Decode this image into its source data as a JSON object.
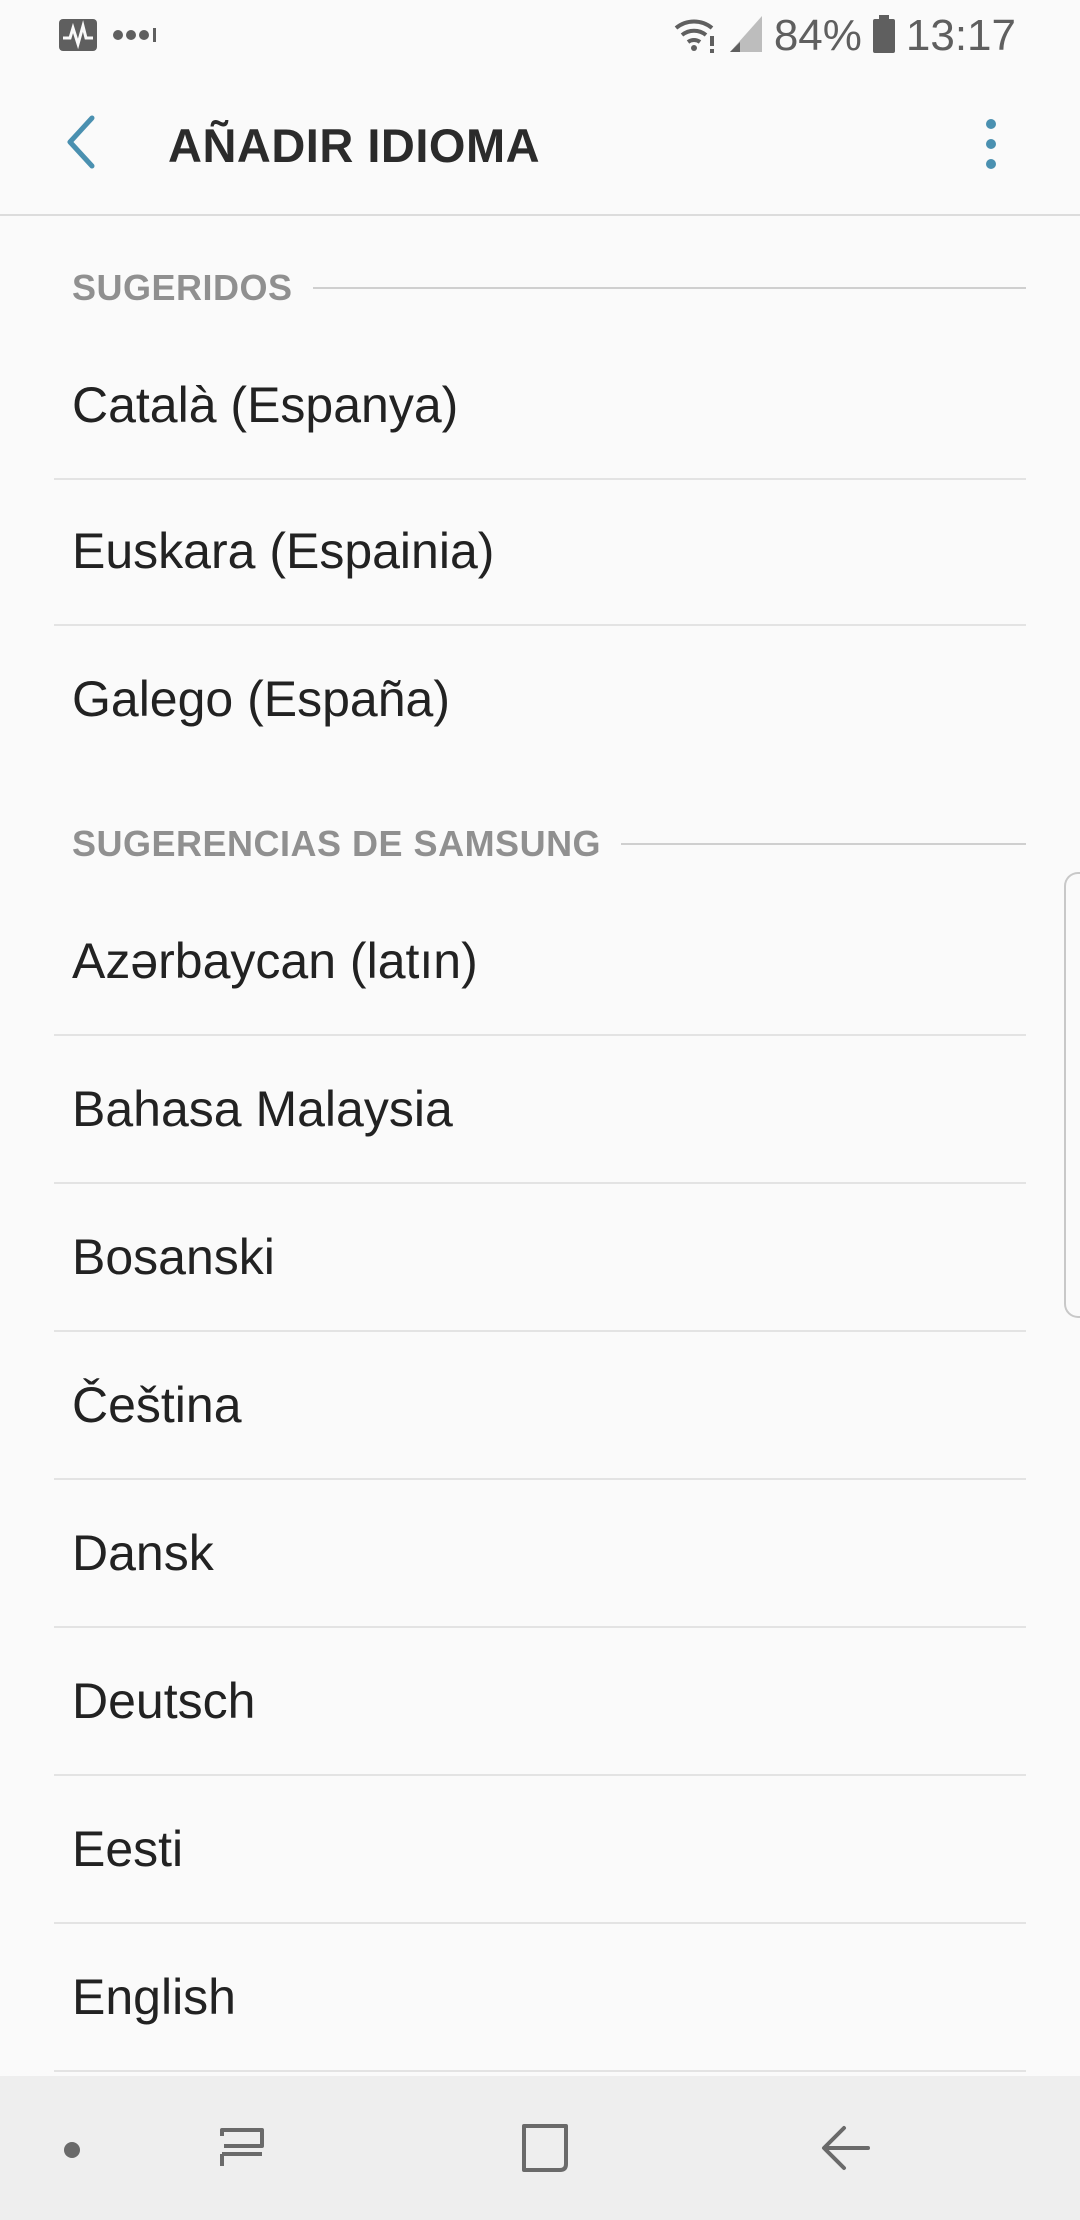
{
  "status_bar": {
    "battery_percent": "84%",
    "time": "13:17",
    "icons": [
      "activity-icon",
      "more-dots-icon",
      "wifi-icon",
      "signal-icon",
      "battery-icon"
    ]
  },
  "app_bar": {
    "title": "AÑADIR IDIOMA",
    "back_icon": "back-arrow-icon",
    "more_icon": "more-vert-icon"
  },
  "sections": [
    {
      "title": "SUGERIDOS",
      "items": [
        "Català (Espanya)",
        "Euskara (Espainia)",
        "Galego (España)"
      ]
    },
    {
      "title": "SUGERENCIAS DE SAMSUNG",
      "items": [
        "Azərbaycan (latın)",
        "Bahasa Malaysia",
        "Bosanski",
        "Čeština",
        "Dansk",
        "Deutsch",
        "Eesti",
        "English"
      ]
    }
  ],
  "nav_bar": {
    "icons": [
      "nav-dot-icon",
      "recents-icon",
      "home-icon",
      "back-icon"
    ]
  },
  "colors": {
    "accent": "#4a90b0",
    "background": "#fafafa",
    "section_title": "#909090",
    "text": "#222222"
  }
}
